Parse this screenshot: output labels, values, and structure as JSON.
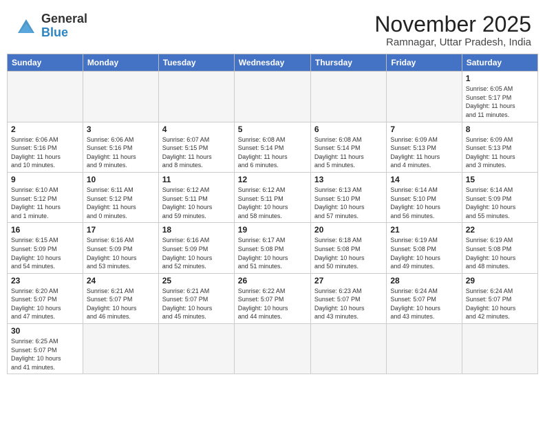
{
  "header": {
    "logo_general": "General",
    "logo_blue": "Blue",
    "month_title": "November 2025",
    "location": "Ramnagar, Uttar Pradesh, India"
  },
  "weekdays": [
    "Sunday",
    "Monday",
    "Tuesday",
    "Wednesday",
    "Thursday",
    "Friday",
    "Saturday"
  ],
  "weeks": [
    [
      {
        "day": "",
        "info": ""
      },
      {
        "day": "",
        "info": ""
      },
      {
        "day": "",
        "info": ""
      },
      {
        "day": "",
        "info": ""
      },
      {
        "day": "",
        "info": ""
      },
      {
        "day": "",
        "info": ""
      },
      {
        "day": "1",
        "info": "Sunrise: 6:05 AM\nSunset: 5:17 PM\nDaylight: 11 hours\nand 11 minutes."
      }
    ],
    [
      {
        "day": "2",
        "info": "Sunrise: 6:06 AM\nSunset: 5:16 PM\nDaylight: 11 hours\nand 10 minutes."
      },
      {
        "day": "3",
        "info": "Sunrise: 6:06 AM\nSunset: 5:16 PM\nDaylight: 11 hours\nand 9 minutes."
      },
      {
        "day": "4",
        "info": "Sunrise: 6:07 AM\nSunset: 5:15 PM\nDaylight: 11 hours\nand 8 minutes."
      },
      {
        "day": "5",
        "info": "Sunrise: 6:08 AM\nSunset: 5:14 PM\nDaylight: 11 hours\nand 6 minutes."
      },
      {
        "day": "6",
        "info": "Sunrise: 6:08 AM\nSunset: 5:14 PM\nDaylight: 11 hours\nand 5 minutes."
      },
      {
        "day": "7",
        "info": "Sunrise: 6:09 AM\nSunset: 5:13 PM\nDaylight: 11 hours\nand 4 minutes."
      },
      {
        "day": "8",
        "info": "Sunrise: 6:09 AM\nSunset: 5:13 PM\nDaylight: 11 hours\nand 3 minutes."
      }
    ],
    [
      {
        "day": "9",
        "info": "Sunrise: 6:10 AM\nSunset: 5:12 PM\nDaylight: 11 hours\nand 1 minute."
      },
      {
        "day": "10",
        "info": "Sunrise: 6:11 AM\nSunset: 5:12 PM\nDaylight: 11 hours\nand 0 minutes."
      },
      {
        "day": "11",
        "info": "Sunrise: 6:12 AM\nSunset: 5:11 PM\nDaylight: 10 hours\nand 59 minutes."
      },
      {
        "day": "12",
        "info": "Sunrise: 6:12 AM\nSunset: 5:11 PM\nDaylight: 10 hours\nand 58 minutes."
      },
      {
        "day": "13",
        "info": "Sunrise: 6:13 AM\nSunset: 5:10 PM\nDaylight: 10 hours\nand 57 minutes."
      },
      {
        "day": "14",
        "info": "Sunrise: 6:14 AM\nSunset: 5:10 PM\nDaylight: 10 hours\nand 56 minutes."
      },
      {
        "day": "15",
        "info": "Sunrise: 6:14 AM\nSunset: 5:09 PM\nDaylight: 10 hours\nand 55 minutes."
      }
    ],
    [
      {
        "day": "16",
        "info": "Sunrise: 6:15 AM\nSunset: 5:09 PM\nDaylight: 10 hours\nand 54 minutes."
      },
      {
        "day": "17",
        "info": "Sunrise: 6:16 AM\nSunset: 5:09 PM\nDaylight: 10 hours\nand 53 minutes."
      },
      {
        "day": "18",
        "info": "Sunrise: 6:16 AM\nSunset: 5:09 PM\nDaylight: 10 hours\nand 52 minutes."
      },
      {
        "day": "19",
        "info": "Sunrise: 6:17 AM\nSunset: 5:08 PM\nDaylight: 10 hours\nand 51 minutes."
      },
      {
        "day": "20",
        "info": "Sunrise: 6:18 AM\nSunset: 5:08 PM\nDaylight: 10 hours\nand 50 minutes."
      },
      {
        "day": "21",
        "info": "Sunrise: 6:19 AM\nSunset: 5:08 PM\nDaylight: 10 hours\nand 49 minutes."
      },
      {
        "day": "22",
        "info": "Sunrise: 6:19 AM\nSunset: 5:08 PM\nDaylight: 10 hours\nand 48 minutes."
      }
    ],
    [
      {
        "day": "23",
        "info": "Sunrise: 6:20 AM\nSunset: 5:07 PM\nDaylight: 10 hours\nand 47 minutes."
      },
      {
        "day": "24",
        "info": "Sunrise: 6:21 AM\nSunset: 5:07 PM\nDaylight: 10 hours\nand 46 minutes."
      },
      {
        "day": "25",
        "info": "Sunrise: 6:21 AM\nSunset: 5:07 PM\nDaylight: 10 hours\nand 45 minutes."
      },
      {
        "day": "26",
        "info": "Sunrise: 6:22 AM\nSunset: 5:07 PM\nDaylight: 10 hours\nand 44 minutes."
      },
      {
        "day": "27",
        "info": "Sunrise: 6:23 AM\nSunset: 5:07 PM\nDaylight: 10 hours\nand 43 minutes."
      },
      {
        "day": "28",
        "info": "Sunrise: 6:24 AM\nSunset: 5:07 PM\nDaylight: 10 hours\nand 43 minutes."
      },
      {
        "day": "29",
        "info": "Sunrise: 6:24 AM\nSunset: 5:07 PM\nDaylight: 10 hours\nand 42 minutes."
      }
    ],
    [
      {
        "day": "30",
        "info": "Sunrise: 6:25 AM\nSunset: 5:07 PM\nDaylight: 10 hours\nand 41 minutes."
      },
      {
        "day": "",
        "info": ""
      },
      {
        "day": "",
        "info": ""
      },
      {
        "day": "",
        "info": ""
      },
      {
        "day": "",
        "info": ""
      },
      {
        "day": "",
        "info": ""
      },
      {
        "day": "",
        "info": ""
      }
    ]
  ]
}
